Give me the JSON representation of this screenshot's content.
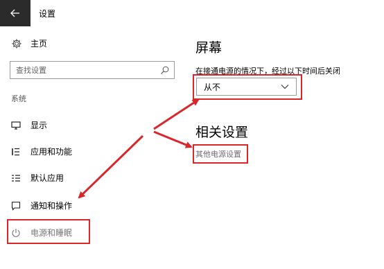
{
  "titlebar": {
    "title": "设置",
    "back_icon": "arrow-left-icon"
  },
  "sidebar": {
    "home": {
      "label": "主页",
      "icon": "gear-icon"
    },
    "search": {
      "placeholder": "查找设置",
      "icon": "search-icon"
    },
    "section_label": "系统",
    "items": [
      {
        "label": "显示",
        "icon": "monitor-icon"
      },
      {
        "label": "应用和功能",
        "icon": "list-icon"
      },
      {
        "label": "默认应用",
        "icon": "default-apps-icon"
      },
      {
        "label": "通知和操作",
        "icon": "message-icon"
      },
      {
        "label": "电源和睡眠",
        "icon": "power-icon",
        "selected": true
      }
    ]
  },
  "main": {
    "screen": {
      "title": "屏幕",
      "description": "在接通电源的情况下，经过以下时间后关闭",
      "dropdown_value": "从不",
      "dropdown_icon": "chevron-down-icon"
    },
    "related": {
      "title": "相关设置",
      "link": "其他电源设置"
    }
  },
  "annotations": {
    "color": "#d9262b"
  }
}
